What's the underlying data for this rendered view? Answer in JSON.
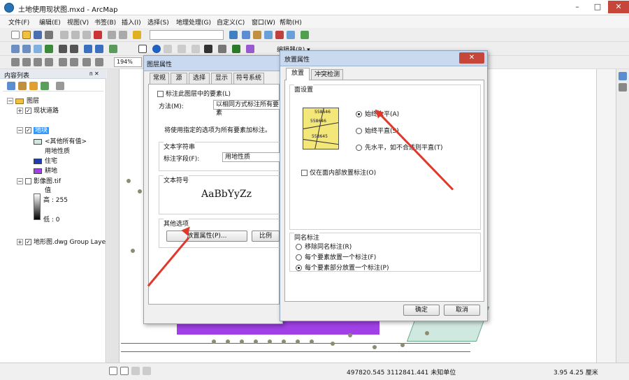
{
  "window": {
    "title": "土地使用现状图.mxd - ArcMap",
    "minimize": "–",
    "maximize": "□",
    "close": "✕"
  },
  "menu": [
    "文件(F)",
    "编辑(E)",
    "视图(V)",
    "书签(B)",
    "插入(I)",
    "选择(S)",
    "地理处理(G)",
    "自定义(C)",
    "窗口(W)",
    "帮助(H)"
  ],
  "toolbar": {
    "scale": "",
    "zoom": "194%",
    "editor_label": "编辑器(R) ▾"
  },
  "toc": {
    "title": "内容列表",
    "pin": "ᴨ ✕",
    "layers_root": "图层",
    "items": [
      {
        "label": "现状道路",
        "checked": true
      },
      {
        "label": "地块",
        "checked": true,
        "selected": true
      },
      {
        "label": "<其他所有值>"
      },
      {
        "label": "用地性质"
      },
      {
        "label": "住宅"
      },
      {
        "label": "耕地"
      },
      {
        "label": "影像图.tif",
        "checked": false
      },
      {
        "label": "值"
      },
      {
        "label": "高 : 255"
      },
      {
        "label": "低 : 0"
      },
      {
        "label": "地形图.dwg Group Laye",
        "checked": true
      }
    ],
    "colors": {
      "other": "#cfe8e0",
      "residential": "#1e3db4",
      "farmland": "#a040e6"
    }
  },
  "status": {
    "coords": "497820.545   3112841.441 未知单位",
    "scale_info": "3.95   4.25 厘米"
  },
  "layer_props": {
    "title": "图层属性",
    "tabs": [
      "常规",
      "源",
      "选择",
      "显示",
      "符号系统"
    ],
    "label_all_checkbox": "标注此图层中的要素(L)",
    "method_label": "方法(M):",
    "method_value": "以相同方式标注所有要素",
    "info": "将使用指定的选项为所有要素加标注。",
    "text_string_group": "文本字符串",
    "label_field_label": "标注字段(F):",
    "label_field_value": "用地性质",
    "text_symbol_group": "文本符号",
    "symbol_preview": "AaBbYyZz",
    "other_options_group": "其他选项",
    "placement_button": "放置属性(P)...",
    "scale_button": "比例"
  },
  "placement": {
    "title": "放置属性",
    "tabs": [
      "放置",
      "冲突检测"
    ],
    "polygon_group": "面设置",
    "preview_labels": [
      "558646",
      "558646",
      "558645"
    ],
    "options": [
      {
        "label": "始终水平(A)",
        "selected": true
      },
      {
        "label": "始终平直(S)",
        "selected": false
      },
      {
        "label": "先水平，如不合适则平直(T)",
        "selected": false
      }
    ],
    "inside_only": "仅在面内部放置标注(O)",
    "duplicate_group": "同名标注",
    "duplicate_options": [
      {
        "label": "移除同名标注(R)",
        "selected": false
      },
      {
        "label": "每个要素放置一个标注(F)",
        "selected": false
      },
      {
        "label": "每个要素部分放置一个标注(P)",
        "selected": true
      }
    ],
    "ok": "确定",
    "cancel": "取消",
    "close": "✕"
  },
  "accent": {
    "arrow": "#e0382b",
    "selection": "#3399ff"
  }
}
